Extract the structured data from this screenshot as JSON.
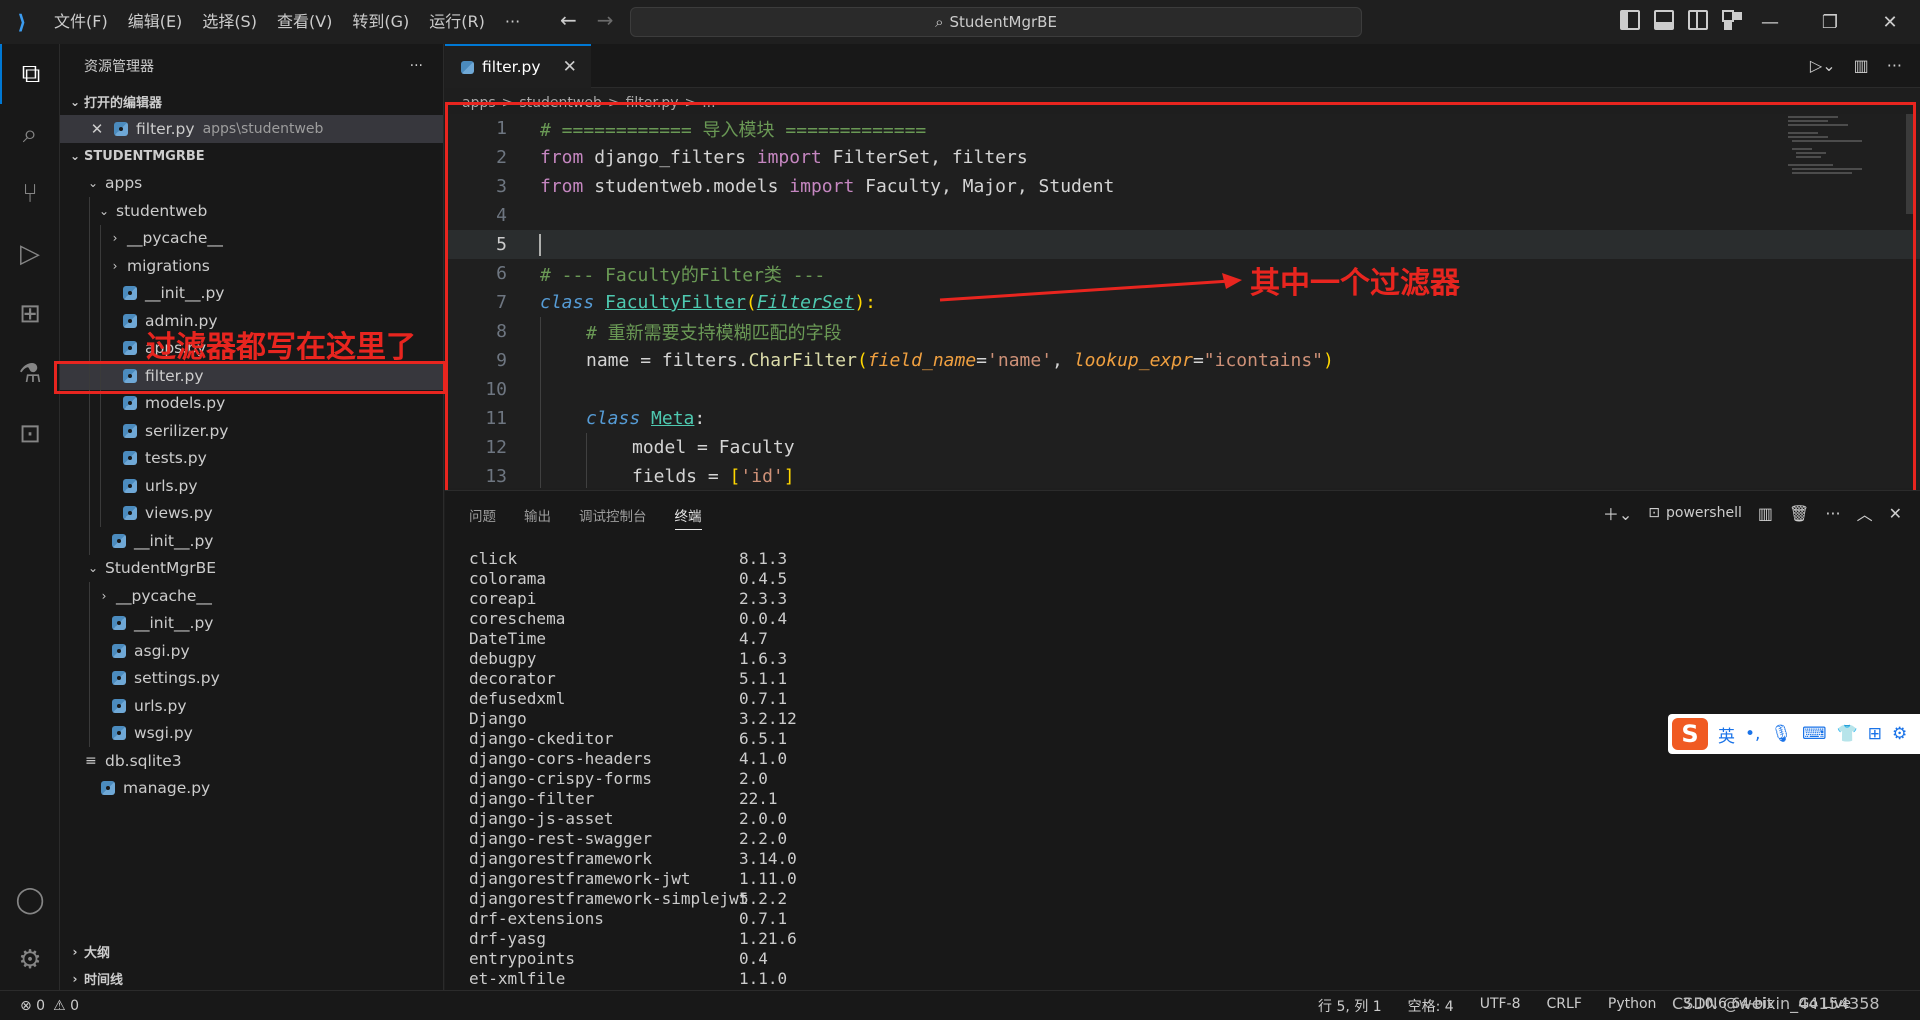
{
  "titlebar": {
    "menu": [
      "文件(F)",
      "编辑(E)",
      "选择(S)",
      "查看(V)",
      "转到(G)",
      "运行(R)",
      "···"
    ],
    "search": "StudentMgrBE",
    "window_controls": [
      "—",
      "❐",
      "✕"
    ]
  },
  "sidebar": {
    "title": "资源管理器",
    "more": "···",
    "open_editors_header": "打开的编辑器",
    "open_editor": {
      "name": "filter.py",
      "path": "apps\\studentweb"
    },
    "project_header": "STUDENTMGRBE",
    "tree": [
      {
        "label": "apps",
        "kind": "folder-open",
        "depth": 1
      },
      {
        "label": "studentweb",
        "kind": "folder-open",
        "depth": 2
      },
      {
        "label": "__pycache__",
        "kind": "folder",
        "depth": 3
      },
      {
        "label": "migrations",
        "kind": "folder",
        "depth": 3
      },
      {
        "label": "__init__.py",
        "kind": "py",
        "depth": 3
      },
      {
        "label": "admin.py",
        "kind": "py",
        "depth": 3
      },
      {
        "label": "apps.py",
        "kind": "py",
        "depth": 3
      },
      {
        "label": "filter.py",
        "kind": "py",
        "depth": 3,
        "selected": true
      },
      {
        "label": "models.py",
        "kind": "py",
        "depth": 3
      },
      {
        "label": "serilizer.py",
        "kind": "py",
        "depth": 3
      },
      {
        "label": "tests.py",
        "kind": "py",
        "depth": 3
      },
      {
        "label": "urls.py",
        "kind": "py",
        "depth": 3
      },
      {
        "label": "views.py",
        "kind": "py",
        "depth": 3
      },
      {
        "label": "__init__.py",
        "kind": "py",
        "depth": 2
      },
      {
        "label": "StudentMgrBE",
        "kind": "folder-open",
        "depth": 1
      },
      {
        "label": "__pycache__",
        "kind": "folder",
        "depth": 2
      },
      {
        "label": "__init__.py",
        "kind": "py",
        "depth": 2
      },
      {
        "label": "asgi.py",
        "kind": "py",
        "depth": 2
      },
      {
        "label": "settings.py",
        "kind": "py",
        "depth": 2
      },
      {
        "label": "urls.py",
        "kind": "py",
        "depth": 2
      },
      {
        "label": "wsgi.py",
        "kind": "py",
        "depth": 2
      },
      {
        "label": "db.sqlite3",
        "kind": "db",
        "depth": 1
      },
      {
        "label": "manage.py",
        "kind": "py",
        "depth": 1
      }
    ],
    "outline_header": "大纲",
    "timeline_header": "时间线"
  },
  "editor": {
    "tab": {
      "name": "filter.py",
      "close": "✕"
    },
    "breadcrumb": [
      "apps",
      ">",
      "studentweb",
      ">",
      "filter.py",
      ">",
      "..."
    ],
    "line_numbers": [
      "1",
      "2",
      "3",
      "4",
      "5",
      "6",
      "7",
      "8",
      "9",
      "10",
      "11",
      "12",
      "13"
    ],
    "code": {
      "l1": "# ============ 导入模块 =============",
      "l2_a": "from",
      "l2_b": " django_filters ",
      "l2_c": "import",
      "l2_d": " FilterSet, filters",
      "l3_a": "from",
      "l3_b": " studentweb.models ",
      "l3_c": "import",
      "l3_d": " Faculty, Major, Student",
      "l6": "# --- Faculty的Filter类 ---",
      "l7_a": "class",
      "l7_b": "FacultyFilter",
      "l7_c": "(",
      "l7_d": "FilterSet",
      "l7_e": "):",
      "l8": "# 重新需要支持模糊匹配的字段",
      "l9_a": "name",
      "l9_b": " = filters.",
      "l9_c": "CharFilter",
      "l9_d": "(",
      "l9_e": "field_name",
      "l9_f": "=",
      "l9_g": "'name'",
      "l9_h": ", ",
      "l9_i": "lookup_expr",
      "l9_j": "=",
      "l9_k": "\"icontains\"",
      "l9_l": ")",
      "l11_a": "class",
      "l11_b": "Meta",
      "l11_c": ":",
      "l12_a": "model",
      "l12_b": " = ",
      "l12_c": "Faculty",
      "l13_a": "fields",
      "l13_b": " = ",
      "l13_c": "[",
      "l13_d": "'id'",
      "l13_e": "]"
    }
  },
  "annotations": {
    "left": "过滤器都写在这里了",
    "right": "其中一个过滤器"
  },
  "panel": {
    "tabs": [
      "问题",
      "输出",
      "调试控制台",
      "终端"
    ],
    "active_tab": "终端",
    "shell": "powershell",
    "packages": [
      {
        "name": "click",
        "version": "8.1.3"
      },
      {
        "name": "colorama",
        "version": "0.4.5"
      },
      {
        "name": "coreapi",
        "version": "2.3.3"
      },
      {
        "name": "coreschema",
        "version": "0.0.4"
      },
      {
        "name": "DateTime",
        "version": "4.7"
      },
      {
        "name": "debugpy",
        "version": "1.6.3"
      },
      {
        "name": "decorator",
        "version": "5.1.1"
      },
      {
        "name": "defusedxml",
        "version": "0.7.1"
      },
      {
        "name": "Django",
        "version": "3.2.12"
      },
      {
        "name": "django-ckeditor",
        "version": "6.5.1"
      },
      {
        "name": "django-cors-headers",
        "version": "4.1.0"
      },
      {
        "name": "django-crispy-forms",
        "version": "2.0"
      },
      {
        "name": "django-filter",
        "version": "22.1"
      },
      {
        "name": "django-js-asset",
        "version": "2.0.0"
      },
      {
        "name": "django-rest-swagger",
        "version": "2.2.0"
      },
      {
        "name": "djangorestframework",
        "version": "3.14.0"
      },
      {
        "name": "djangorestframework-jwt",
        "version": "1.11.0"
      },
      {
        "name": "djangorestframework-simplejwt",
        "version": "5.2.2"
      },
      {
        "name": "drf-extensions",
        "version": "0.7.1"
      },
      {
        "name": "drf-yasg",
        "version": "1.21.6"
      },
      {
        "name": "entrypoints",
        "version": "0.4"
      },
      {
        "name": "et-xmlfile",
        "version": "1.1.0"
      }
    ]
  },
  "ime": {
    "logo": "S",
    "lang": "英"
  },
  "statusbar": {
    "errors": "⊗ 0",
    "warnings": "⚠ 0",
    "position": "行 5, 列 1",
    "spaces": "空格: 4",
    "encoding": "UTF-8",
    "eol": "CRLF",
    "language": "Python",
    "interpreter": "3.10.6 64-bit",
    "live": "Go Live",
    "watermark": "CSDN @weixin_44154358"
  },
  "colors": {
    "accent": "#0078d4",
    "annotation": "#e8251f"
  }
}
